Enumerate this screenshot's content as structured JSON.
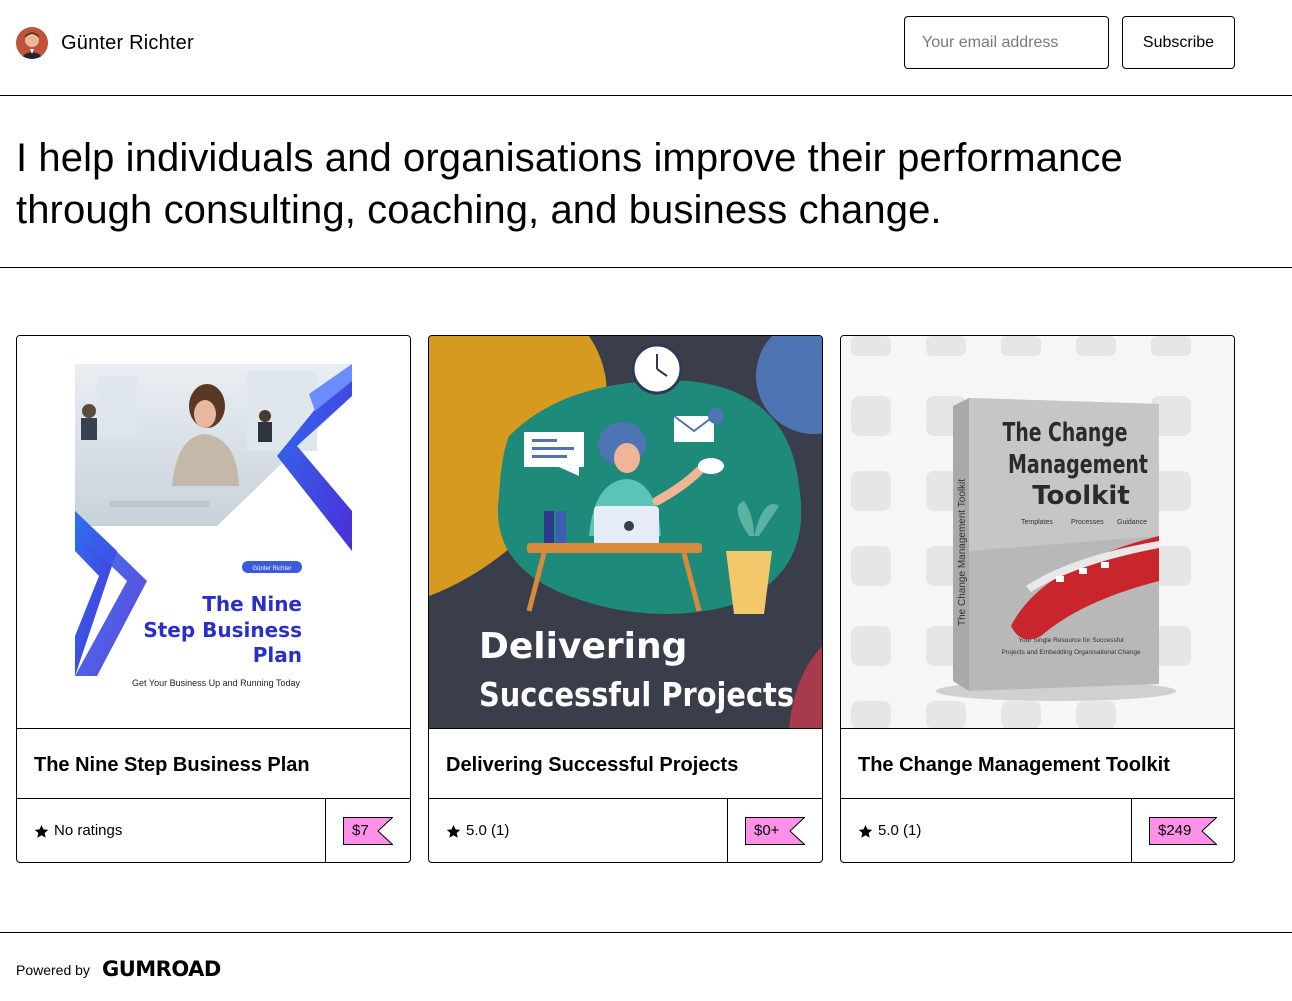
{
  "header": {
    "creator_name": "Günter Richter",
    "email_placeholder": "Your email address",
    "subscribe_label": "Subscribe"
  },
  "bio": {
    "text": "I help individuals and organisations improve their performance through consulting, coaching, and business change."
  },
  "products": [
    {
      "title": "The Nine Step Business Plan",
      "rating_text": "No ratings",
      "price": "$7",
      "cover": {
        "badge": "Günter Richter",
        "line1": "The Nine",
        "line2": "Step Business",
        "line3": "Plan",
        "tagline": "Get Your Business Up and Running Today"
      }
    },
    {
      "title": "Delivering Successful Projects",
      "rating_text": "5.0 (1)",
      "price": "$0+",
      "cover": {
        "line1": "Delivering",
        "line2": "Successful Projects"
      }
    },
    {
      "title": "The Change Management Toolkit",
      "rating_text": "5.0 (1)",
      "price": "$249",
      "cover": {
        "line1": "The Change",
        "line2": "Management",
        "line3": "Toolkit",
        "spine": "The Change Management Toolkit",
        "features": [
          "Templates",
          "Processes",
          "Guidance"
        ],
        "blurb1": "Your Single Resource for Successful",
        "blurb2": "Projects and Embedding Organisational Change"
      }
    }
  ],
  "footer": {
    "powered_by": "Powered by",
    "brand": "GUMROAD"
  },
  "colors": {
    "price_tag": "#ff90e8",
    "border": "#000000",
    "cover2_bg": "#3a3d4a",
    "cover2_teal": "#1e8a7a",
    "cover2_mustard": "#d69a1e",
    "cover1_blue": "#3b3fd6"
  }
}
